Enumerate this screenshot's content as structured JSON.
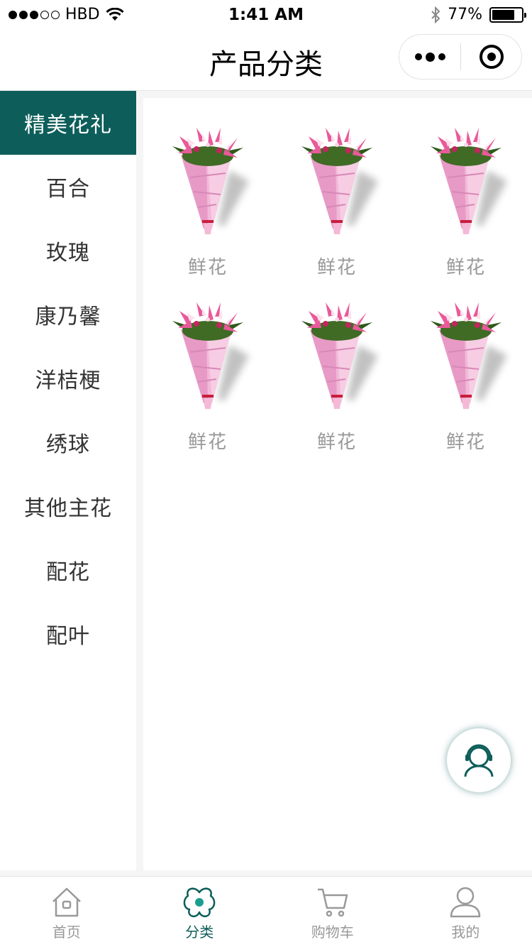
{
  "status_bar": {
    "carrier": "HBD",
    "time": "1:41 AM",
    "battery": "77%",
    "battery_level": 0.77
  },
  "nav": {
    "title": "产品分类"
  },
  "sidebar": {
    "items": [
      {
        "label": "精美花礼",
        "active": true
      },
      {
        "label": "百合"
      },
      {
        "label": "玫瑰"
      },
      {
        "label": "康乃馨"
      },
      {
        "label": "洋桔梗"
      },
      {
        "label": "绣球"
      },
      {
        "label": "其他主花"
      },
      {
        "label": "配花"
      },
      {
        "label": "配叶"
      }
    ]
  },
  "products": [
    {
      "name": "鲜花",
      "icon": "lily-bouquet-image"
    },
    {
      "name": "鲜花",
      "icon": "lily-bouquet-image"
    },
    {
      "name": "鲜花",
      "icon": "lily-bouquet-image"
    },
    {
      "name": "鲜花",
      "icon": "lily-bouquet-image"
    },
    {
      "name": "鲜花",
      "icon": "lily-bouquet-image"
    },
    {
      "name": "鲜花",
      "icon": "lily-bouquet-image"
    }
  ],
  "tab_bar": {
    "tabs": [
      {
        "label": "首页",
        "icon": "home-icon"
      },
      {
        "label": "分类",
        "icon": "category-icon",
        "active": true
      },
      {
        "label": "购物车",
        "icon": "cart-icon"
      },
      {
        "label": "我的",
        "icon": "user-icon"
      }
    ]
  },
  "colors": {
    "accent": "#0d5e5a",
    "inactive_text": "#999999"
  }
}
